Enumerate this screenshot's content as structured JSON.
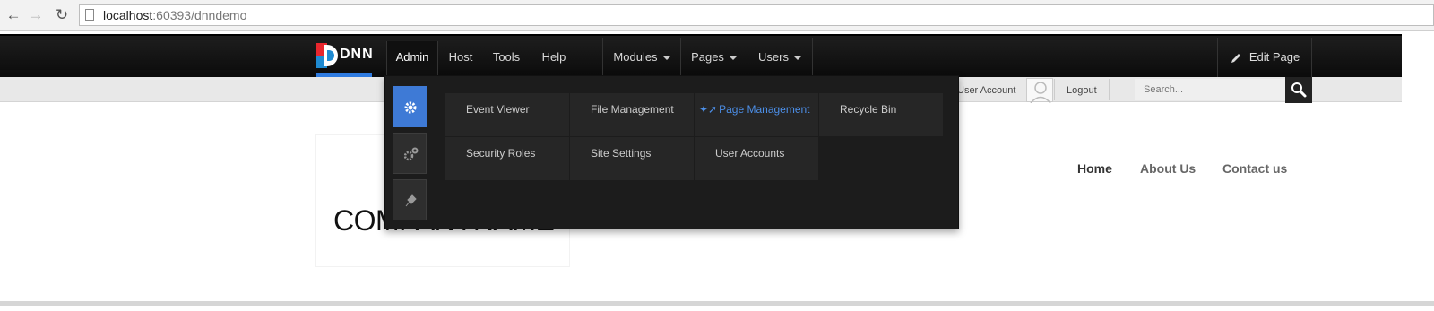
{
  "browser": {
    "url_host": "localhost",
    "url_rest": ":60393/dnndemo"
  },
  "control_bar": {
    "logo_text": "DNN",
    "menu": [
      {
        "label": "Admin",
        "active": true
      },
      {
        "label": "Host"
      },
      {
        "label": "Tools"
      },
      {
        "label": "Help"
      }
    ],
    "dropdowns": [
      {
        "label": "Modules"
      },
      {
        "label": "Pages"
      },
      {
        "label": "Users"
      }
    ],
    "edit_page": "Edit Page"
  },
  "user_bar": {
    "user_account": "User Account",
    "logout": "Logout",
    "search_placeholder": "Search..."
  },
  "admin_menu": {
    "items": [
      {
        "label": "Event Viewer"
      },
      {
        "label": "File Management"
      },
      {
        "label": "Page Management",
        "current": true
      },
      {
        "label": "Recycle Bin"
      },
      {
        "label": "Security Roles"
      },
      {
        "label": "Site Settings"
      },
      {
        "label": "User Accounts"
      }
    ]
  },
  "site": {
    "company_name": "COMPANYNAME",
    "nav": [
      {
        "label": "Home"
      },
      {
        "label": "About Us"
      },
      {
        "label": "Contact us"
      }
    ]
  },
  "colors": {
    "accent": "#3e7ad6",
    "logo_red": "#e8262d",
    "logo_blue": "#1f8ad1"
  }
}
